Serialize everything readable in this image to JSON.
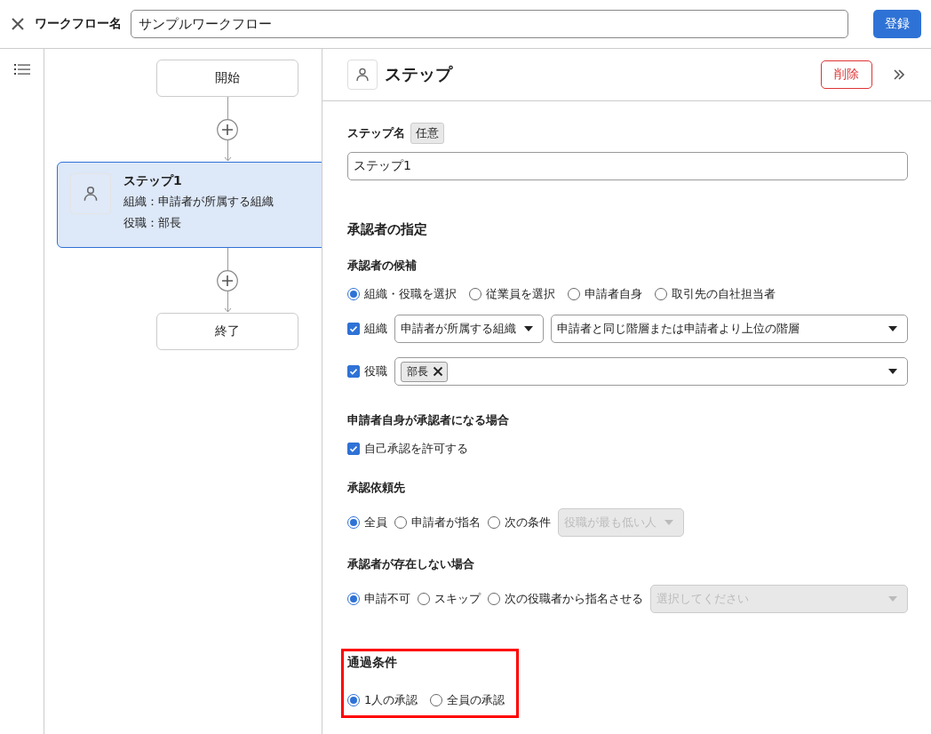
{
  "header": {
    "label": "ワークフロー名",
    "workflow_name": "サンプルワークフロー",
    "save_button": "登録"
  },
  "flow": {
    "nodes": [
      {
        "kind": "terminal",
        "label": "開始"
      },
      {
        "kind": "add"
      },
      {
        "kind": "step",
        "title": "ステップ1",
        "lines": [
          "組織：申請者が所属する組織",
          "役職：部長"
        ],
        "selected": true
      },
      {
        "kind": "add"
      },
      {
        "kind": "terminal",
        "label": "終了"
      }
    ]
  },
  "panel": {
    "title": "ステップ",
    "delete_button": "削除",
    "step_name": {
      "label": "ステップ名",
      "badge": "任意",
      "value": "ステップ1"
    },
    "section_title": "承認者の指定",
    "candidates": {
      "label": "承認者の候補",
      "options": [
        {
          "label": "組織・役職を選択",
          "selected": true
        },
        {
          "label": "従業員を選択",
          "selected": false
        },
        {
          "label": "申請者自身",
          "selected": false
        },
        {
          "label": "取引先の自社担当者",
          "selected": false
        }
      ],
      "organization": {
        "label": "組織",
        "checked": true,
        "scope": "申請者が所属する組織",
        "level": "申請者と同じ階層または申請者より上位の階層"
      },
      "position": {
        "label": "役職",
        "checked": true,
        "tags": [
          "部長"
        ]
      }
    },
    "self_approval": {
      "label": "申請者自身が承認者になる場合",
      "option": "自己承認を許可する",
      "checked": true
    },
    "request_to": {
      "label": "承認依頼先",
      "options": [
        {
          "label": "全員",
          "selected": true
        },
        {
          "label": "申請者が指名",
          "selected": false
        },
        {
          "label": "次の条件",
          "selected": false
        }
      ],
      "dropdown": {
        "value": "役職が最も低い人",
        "disabled": true
      }
    },
    "no_approver": {
      "label": "承認者が存在しない場合",
      "options": [
        {
          "label": "申請不可",
          "selected": true
        },
        {
          "label": "スキップ",
          "selected": false
        },
        {
          "label": "次の役職者から指名させる",
          "selected": false
        }
      ],
      "dropdown": {
        "placeholder": "選択してください",
        "disabled": true
      }
    },
    "pass_condition": {
      "label": "通過条件",
      "highlighted": true,
      "options": [
        {
          "label": "1人の承認",
          "selected": true
        },
        {
          "label": "全員の承認",
          "selected": false
        }
      ]
    }
  }
}
